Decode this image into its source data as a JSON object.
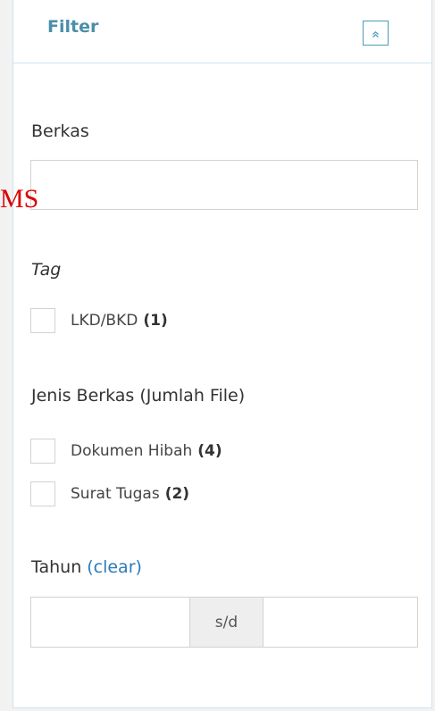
{
  "stray_text": "MS",
  "filter": {
    "title": "Filter",
    "collapse_icon": "chevron-double-up-icon"
  },
  "berkas": {
    "label": "Berkas",
    "value": ""
  },
  "tag": {
    "label": "Tag",
    "items": [
      {
        "label": "LKD/BKD",
        "count": "(1)",
        "checked": false
      }
    ]
  },
  "jenis": {
    "label": "Jenis Berkas (Jumlah File)",
    "items": [
      {
        "label": "Dokumen Hibah",
        "count": "(4)",
        "checked": false
      },
      {
        "label": "Surat Tugas",
        "count": "(2)",
        "checked": false
      }
    ]
  },
  "tahun": {
    "label": "Tahun",
    "clear_label": "(clear)",
    "from": "",
    "separator": "s/d",
    "to": ""
  },
  "colors": {
    "title": "#4a8fa8",
    "link": "#2c7ab8",
    "panel_border": "#cfe3ec",
    "stray_text": "#dd0000"
  }
}
